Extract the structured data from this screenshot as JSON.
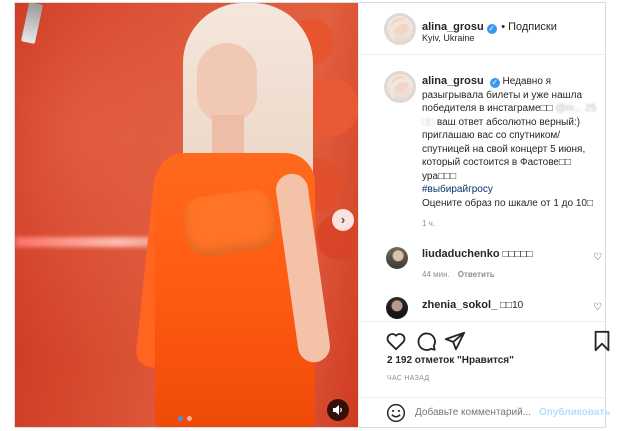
{
  "post": {
    "username": "alina_grosu",
    "follow_label": "• Подписки",
    "location": "Kyiv, Ukraine",
    "caption_username": "alina_grosu",
    "caption_line1": "Недавно я разыгрывала билеты и уже нашла победителя в инстаграме□□",
    "caption_blurred": "@m... 25 □□",
    "caption_line2": "ваш ответ абсолютно верный:) приглашаю вас со спутником/спутницей на свой концерт 5 июня, который состоится в Фастове□□ ура□□□",
    "hashtag": "#выбирайгросу",
    "caption_line3": "Оцените образ по шкале от 1 до 10□",
    "caption_time": "1 ч."
  },
  "comments": [
    {
      "username": "liudaduchenko",
      "text": "□□□□□",
      "time": "44 мин.",
      "reply": "Ответить"
    },
    {
      "username": "zhenia_sokol_",
      "text": "□□10",
      "time": "",
      "reply": ""
    }
  ],
  "likes": "2 192 отметок \"Нравится\"",
  "ago": "ЧАС НАЗАД",
  "add_comment": {
    "placeholder": "Добавьте комментарий...",
    "post_label": "Опубликовать"
  },
  "media": {
    "slide_count": 2,
    "active_slide": 1
  },
  "icons": {
    "like": "heart-icon",
    "comment": "comment-icon",
    "share": "share-icon",
    "save": "bookmark-icon",
    "next": "chevron-right-icon",
    "sound": "speaker-icon",
    "emoji": "smile-icon",
    "verified": "verified-badge-icon"
  },
  "colors": {
    "verified": "#3897f0",
    "post_button": "#b2dffc",
    "hashtag": "#00376b"
  }
}
